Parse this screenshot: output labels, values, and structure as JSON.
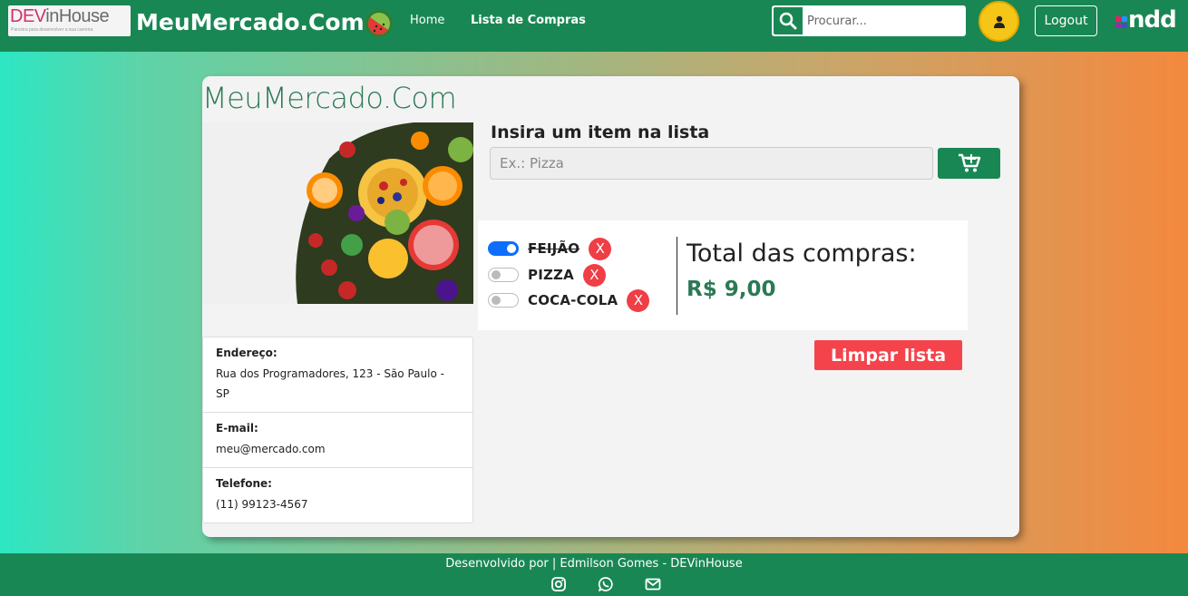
{
  "navbar": {
    "logo_text_dev": "DEV",
    "logo_text_inhouse": "inHouse",
    "logo_tagline": "Parceira para desenvolver a sua carreira",
    "brand_title": "MeuMercado.Com",
    "brand_icon": "watermelon-icon",
    "links": [
      {
        "label": "Home",
        "active": false
      },
      {
        "label": "Lista de Compras",
        "active": true
      }
    ],
    "search_placeholder": "Procurar...",
    "search_icon": "search-icon",
    "avatar_icon": "user-icon",
    "logout_label": "Logout",
    "partner_logo": "ndd"
  },
  "card": {
    "title": "MeuMercado.Com",
    "image": "fruits-photo",
    "contact": [
      {
        "label": "Endereço:",
        "value": "Rua dos Programadores, 123 - São Paulo - SP"
      },
      {
        "label": "E-mail:",
        "value": "meu@mercado.com"
      },
      {
        "label": "Telefone:",
        "value": "(11) 99123-4567"
      }
    ],
    "insert_title": "Insira um item na lista",
    "input_placeholder": "Ex.: Pizza",
    "add_button_icon": "cart-plus-icon",
    "items": [
      {
        "name": "FEIJÃO",
        "checked": true,
        "remove_label": "X"
      },
      {
        "name": "PIZZA",
        "checked": false,
        "remove_label": "X"
      },
      {
        "name": "COCA-COLA",
        "checked": false,
        "remove_label": "X"
      }
    ],
    "total_label": "Total das compras:",
    "total_value": "R$ 9,00",
    "clear_label": "Limpar lista"
  },
  "footer": {
    "text": "Desenvolvido por | Edmilson Gomes - DEVinHouse",
    "icons": [
      "instagram-icon",
      "whatsapp-icon",
      "mail-icon"
    ]
  },
  "colors": {
    "primary_green": "#198754",
    "accent_red": "#f4434b",
    "toggle_blue": "#0d6efd",
    "avatar_yellow": "#f5c518"
  }
}
